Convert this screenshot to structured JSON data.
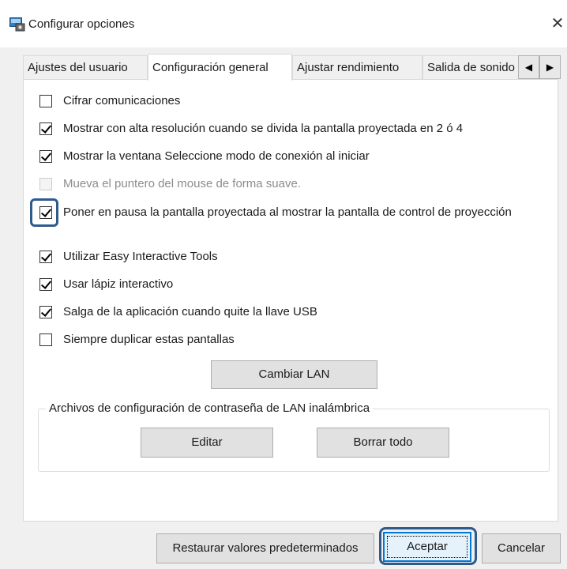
{
  "window": {
    "title": "Configurar opciones",
    "close_glyph": "✕",
    "app_icon": "projector-settings-icon"
  },
  "tabs": [
    {
      "label": "Ajustes del usuario",
      "active": false
    },
    {
      "label": "Configuración general",
      "active": true
    },
    {
      "label": "Ajustar rendimiento",
      "active": false
    },
    {
      "label": "Salida de sonido",
      "active": false
    }
  ],
  "tab_scroll": {
    "left_glyph": "◀",
    "right_glyph": "▶"
  },
  "options": [
    {
      "label": "Cifrar comunicaciones",
      "checked": false,
      "enabled": true
    },
    {
      "label": "Mostrar con alta resolución cuando se divida la pantalla proyectada en 2 ó 4",
      "checked": true,
      "enabled": true
    },
    {
      "label": "Mostrar la ventana Seleccione modo de conexión al iniciar",
      "checked": true,
      "enabled": true
    },
    {
      "label": "Mueva el puntero del mouse de forma suave.",
      "checked": false,
      "enabled": false
    },
    {
      "label": "Poner en pausa la pantalla proyectada al mostrar la pantalla de control de proyección",
      "checked": true,
      "enabled": true
    },
    {
      "label": "Utilizar Easy Interactive Tools",
      "checked": true,
      "enabled": true
    },
    {
      "label": "Usar lápiz interactivo",
      "checked": true,
      "enabled": true
    },
    {
      "label": "Salga de la aplicación cuando quite la llave USB",
      "checked": true,
      "enabled": true
    },
    {
      "label": "Siempre duplicar estas pantallas",
      "checked": false,
      "enabled": true
    }
  ],
  "buttons": {
    "change_lan": "Cambiar LAN",
    "edit": "Editar",
    "clear_all": "Borrar todo",
    "restore_defaults": "Restaurar valores predeterminados",
    "accept": "Aceptar",
    "cancel": "Cancelar"
  },
  "wireless_group": {
    "legend": "Archivos de configuración de contraseña de LAN inalámbrica"
  },
  "colors": {
    "highlight": "#2e5a8c",
    "primary_border": "#0078d7"
  }
}
